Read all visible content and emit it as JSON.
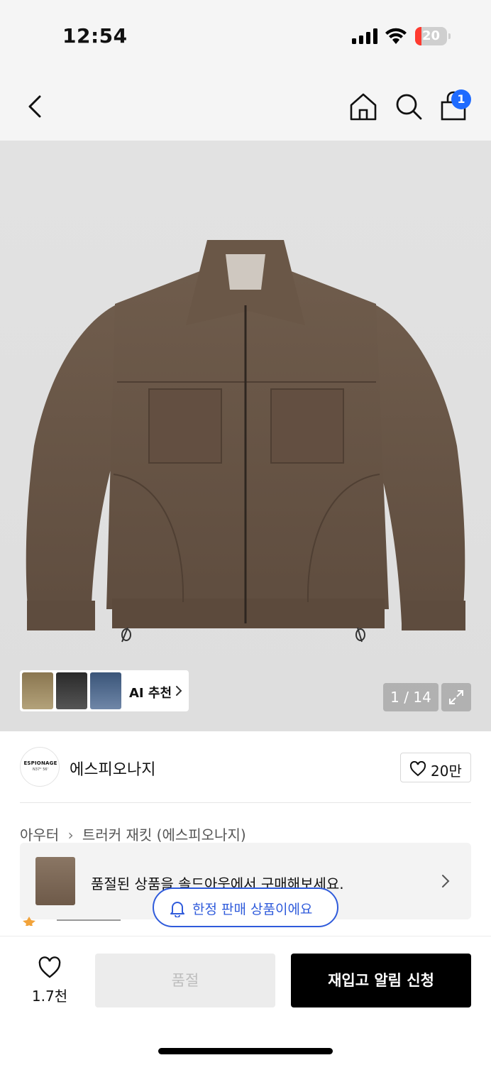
{
  "status_bar": {
    "time": "12:54",
    "battery": "20",
    "battery_level": 0.2
  },
  "nav": {
    "cart_count": "1",
    "icons": [
      "back-chevron-icon",
      "home-icon",
      "search-icon",
      "shopping-bag-icon"
    ]
  },
  "gallery": {
    "ai_recommend_label": "AI 추천",
    "counter": "1 / 14",
    "colors": {
      "jacket": "#6b5849",
      "background": "#e0e0e0"
    }
  },
  "brand": {
    "logo_text": "ESPIONAGE",
    "logo_subtext": "N37° 56'",
    "name": "에스피오나지",
    "like_count": "20만"
  },
  "breadcrumb": {
    "category": "아우터",
    "product": "트러커 재킷 (에스피오나지)"
  },
  "soldout_banner": {
    "text": "품절된 상품을 솔드아웃에서 구매해보세요."
  },
  "limited_badge": {
    "text": "한정 판매 상품이에요"
  },
  "bottom_bar": {
    "wish_count": "1.7천",
    "soldout_label": "품절",
    "notify_label": "재입고 알림 신청",
    "colors": {
      "notify_bg": "#000000",
      "accent_blue": "#2f5bdb"
    }
  }
}
